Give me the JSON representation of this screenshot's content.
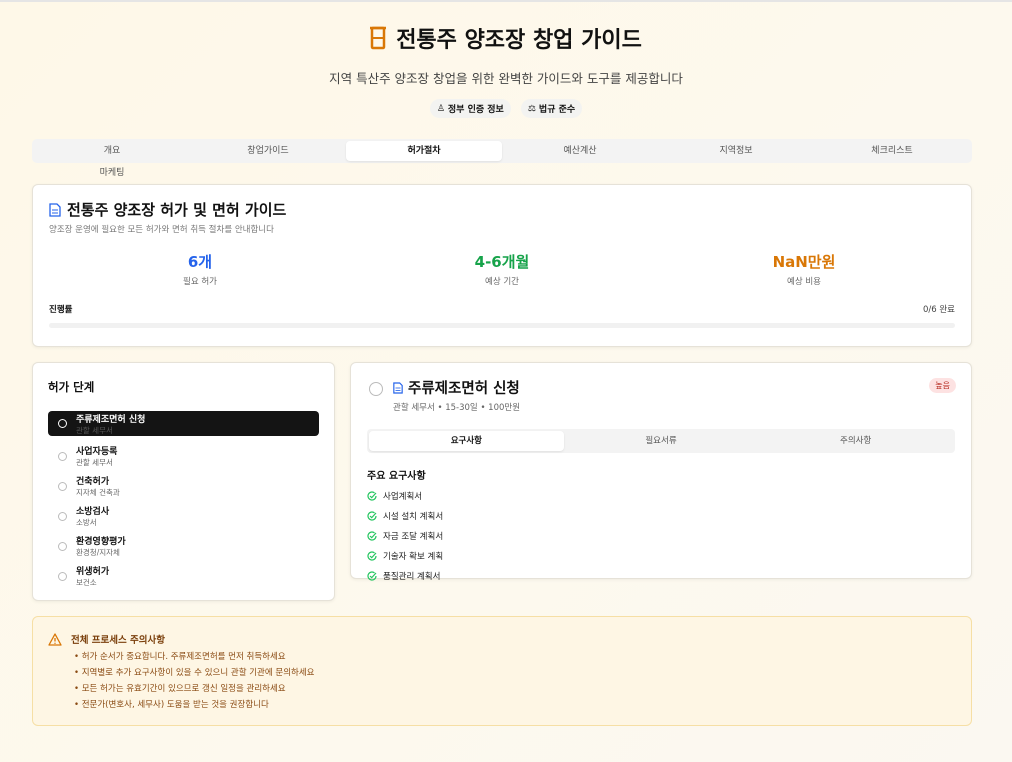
{
  "header": {
    "title": "전통주 양조장 창업 가이드",
    "subtitle": "지역 특산주 양조장 창업을 위한 완벽한 가이드와 도구를 제공합니다",
    "badges": [
      "정부 인증 정보",
      "법규 준수"
    ]
  },
  "tabs": [
    "개요",
    "창업가이드",
    "허가절차",
    "예산계산",
    "지역정보",
    "체크리스트",
    "마케팅"
  ],
  "active_tab": "허가절차",
  "overview": {
    "title": "전통주 양조장 허가 및 면허 가이드",
    "desc": "양조장 운영에 필요한 모든 허가와 면허 취득 절차를 안내합니다",
    "stats": [
      {
        "value": "6개",
        "label": "필요 허가",
        "color": "#2563eb"
      },
      {
        "value": "4-6개월",
        "label": "예상 기간",
        "color": "#16a34a"
      },
      {
        "value": "NaN만원",
        "label": "예상 비용",
        "color": "#d97706"
      }
    ],
    "progress_label": "진행률",
    "progress_text": "0/6 완료",
    "progress": 0
  },
  "steps_panel": {
    "title": "허가 단계",
    "steps": [
      {
        "name": "주류제조면허 신청",
        "sub": "관할 세무서"
      },
      {
        "name": "사업자등록",
        "sub": "관할 세무서"
      },
      {
        "name": "건축허가",
        "sub": "지자체 건축과"
      },
      {
        "name": "소방검사",
        "sub": "소방서"
      },
      {
        "name": "환경영향평가",
        "sub": "환경청/지자체"
      },
      {
        "name": "위생허가",
        "sub": "보건소"
      }
    ]
  },
  "detail": {
    "title": "주류제조면허 신청",
    "meta": "관할 세무서 • 15-30일 • 100만원",
    "priority": "높음",
    "tabs": [
      "요구사항",
      "필요서류",
      "주의사항"
    ],
    "req_title": "주요 요구사항",
    "requirements": [
      "사업계획서",
      "시설 설치 계획서",
      "자금 조달 계획서",
      "기술자 확보 계획",
      "품질관리 계획서"
    ]
  },
  "warning": {
    "title": "전체 프로세스 주의사항",
    "items": [
      "• 허가 순서가 중요합니다. 주류제조면허를 먼저 취득하세요",
      "• 지역별로 추가 요구사항이 있을 수 있으니 관할 기관에 문의하세요",
      "• 모든 허가는 유효기간이 있으므로 갱신 일정을 관리하세요",
      "• 전문가(변호사, 세무사) 도움을 받는 것을 권장합니다"
    ]
  }
}
